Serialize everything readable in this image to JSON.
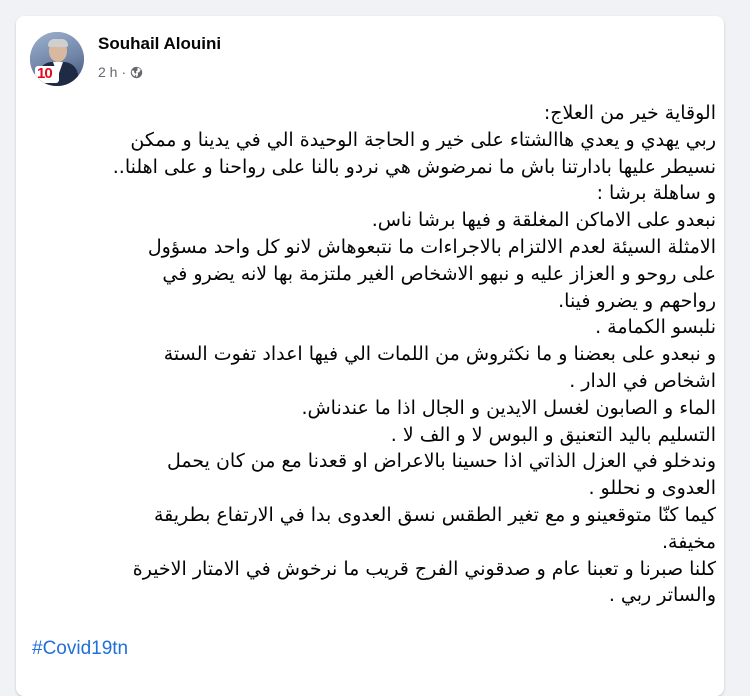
{
  "post": {
    "author": "Souhail Alouini",
    "time": "2 h",
    "separator": "·",
    "privacy_icon": "globe-icon",
    "avatar_logo_text": "10",
    "lines": [
      "الوقاية خير من العلاج:",
      "ربي يهدي و يعدي هاالشتاء على خير  و الحاجة الوحيدة الي في يدينا و ممكن",
      "نسيطر عليها بادارتنا باش ما نمرضوش  هي نردو بالنا على رواحنا و على اهلنا..",
      "و ساهلة برشا   :",
      "نبعدو على الاماكن المغلقة و فيها برشا ناس.",
      "الامثلة السيئة  لعدم الالتزام بالاجراءات ما نتبعوهاش لانو كل واحد مسؤول",
      "على روحو و العزاز عليه و نبهو الاشخاص الغير ملتزمة بها لانه يضرو في",
      "رواحهم و يضرو فينا.",
      "نلبسو الكمامة .",
      "و نبعدو على بعضنا و ما نكثروش من اللمات الي فيها اعداد تفوت الستة",
      "اشخاص في الدار .",
      "الماء و الصابون لغسل الايدين و الجال اذا ما عندناش.",
      "التسليم باليد التعنيق و البوس  لا و الف لا .",
      "وندخلو في العزل الذاتي اذا حسينا بالاعراض او قعدنا مع من كان يحمل",
      "العدوى و نحللو .",
      "كيما كنّا متوقعينو و مع تغير الطقس نسق العدوى بدا في الارتفاع بطريقة",
      "مخيفة.",
      "كلنا صبرنا و تعبنا  عام و صدقوني الفرج قريب  ما نرخوش في الامتار الاخيرة",
      "والساتر ربي ."
    ],
    "hashtag": "#Covid19tn"
  },
  "colors": {
    "page_bg": "#f0f2f5",
    "card_bg": "#ffffff",
    "text": "#050505",
    "meta": "#65676b",
    "link": "#216fdb"
  }
}
